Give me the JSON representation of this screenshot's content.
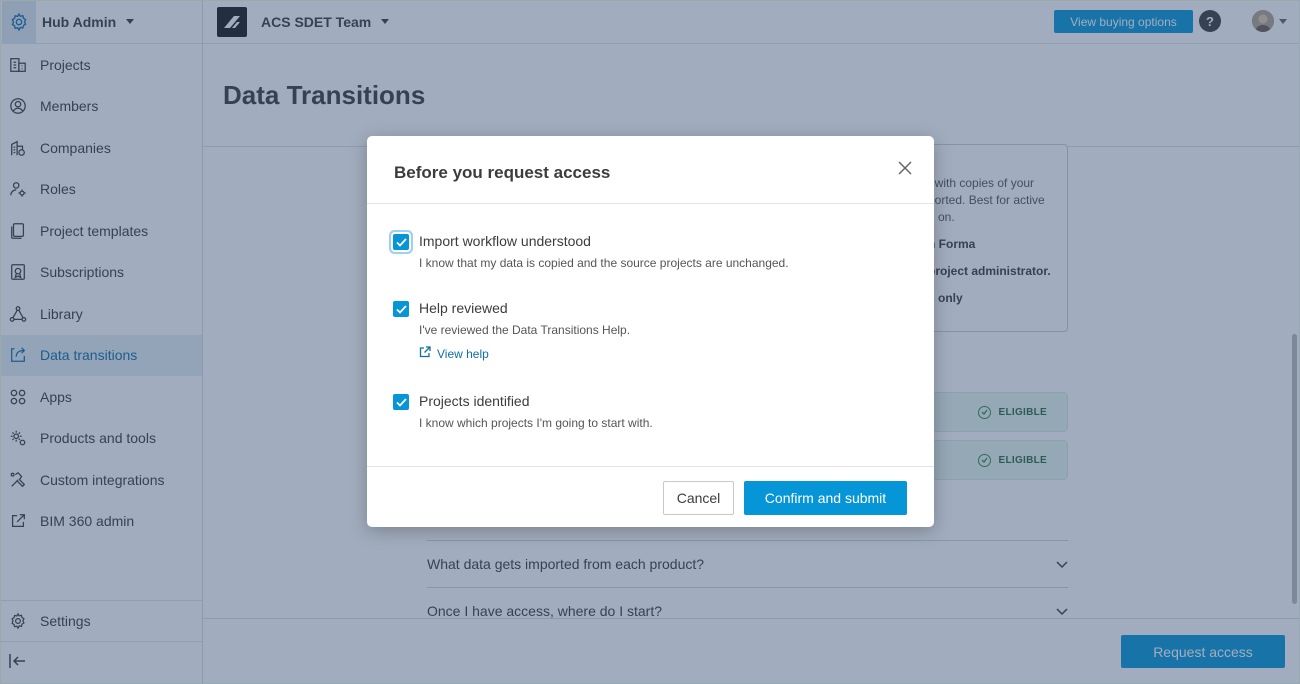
{
  "hub": {
    "title": "Hub Admin"
  },
  "sidebar": {
    "items": [
      {
        "label": "Projects",
        "icon": "projects-icon"
      },
      {
        "label": "Members",
        "icon": "members-icon"
      },
      {
        "label": "Companies",
        "icon": "companies-icon"
      },
      {
        "label": "Roles",
        "icon": "roles-icon"
      },
      {
        "label": "Project templates",
        "icon": "templates-icon"
      },
      {
        "label": "Subscriptions",
        "icon": "subscriptions-icon"
      },
      {
        "label": "Library",
        "icon": "library-icon"
      },
      {
        "label": "Data transitions",
        "icon": "data-transitions-icon",
        "active": true
      },
      {
        "label": "Apps",
        "icon": "apps-icon"
      },
      {
        "label": "Products and tools",
        "icon": "products-icon"
      },
      {
        "label": "Custom integrations",
        "icon": "integrations-icon"
      },
      {
        "label": "BIM 360 admin",
        "icon": "external-link-icon"
      }
    ],
    "settings_label": "Settings"
  },
  "topbar": {
    "team_name": "ACS SDET Team",
    "buy_label": "View buying options",
    "help_label": "?"
  },
  "main": {
    "page_title": "Data Transitions",
    "card_lines": [
      "t with copies of your",
      "ported. Best for active",
      "g on."
    ],
    "card_bold": [
      "n Forma",
      "project administrator.",
      "s only"
    ],
    "eligible_label": "ELIGIBLE",
    "faq": [
      "What data gets imported from each product?",
      "Once I have access, where do I start?"
    ],
    "request_label": "Request access"
  },
  "modal": {
    "title": "Before you request access",
    "options": [
      {
        "label": "Import workflow understood",
        "desc": "I know that my data is copied and the source projects are unchanged.",
        "checked": true
      },
      {
        "label": "Help reviewed",
        "desc": "I've reviewed the Data Transitions Help.",
        "checked": true,
        "link": "View help"
      },
      {
        "label": "Projects identified",
        "desc": "I know which projects I'm going to start with.",
        "checked": true
      }
    ],
    "cancel_label": "Cancel",
    "confirm_label": "Confirm and submit"
  },
  "colors": {
    "accent": "#0696d7",
    "overlay": "#2e496e",
    "eligible_bg": "#eaf6ee"
  }
}
